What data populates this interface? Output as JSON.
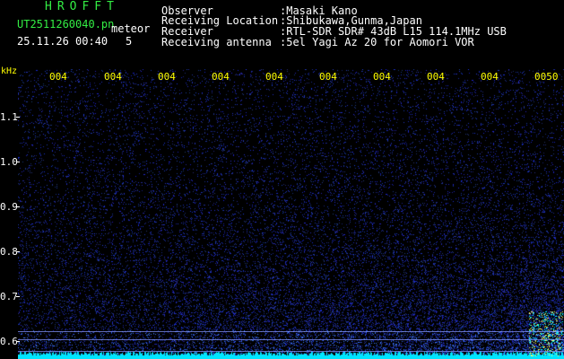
{
  "header": {
    "app_title": "HROFFT",
    "file_name": "UT2511260040.pn",
    "meteor_label": "meteor",
    "datetime": "25.11.26 00:40",
    "count": "5",
    "info": [
      {
        "label": "Observer",
        "value": ":Masaki Kano"
      },
      {
        "label": "Receiving Location",
        "value": ":Shibukawa,Gunma,Japan"
      },
      {
        "label": "Receiver",
        "value": ":RTL-SDR SDR# 43dB L15 114.1MHz USB"
      },
      {
        "label": "Receiving antenna",
        "value": ":5el Yagi Az 20 for Aomori VOR"
      }
    ]
  },
  "axes": {
    "unit": "kHz",
    "y_ticks": [
      "1.1",
      "1.0",
      "0.9",
      "0.8",
      "0.7",
      "0.6"
    ],
    "x_ticks": [
      "004",
      "004",
      "004",
      "004",
      "004",
      "004",
      "004",
      "004",
      "004",
      "0050"
    ]
  },
  "colors": {
    "background": "#000000",
    "header_text": "#ffffff",
    "title_text": "#33ee44",
    "tick_labels": "#ffff00",
    "noise": "#1a2a9a",
    "signal": "#00ffff"
  }
}
